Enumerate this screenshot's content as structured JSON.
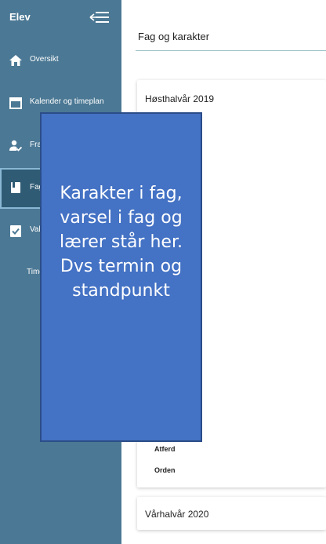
{
  "sidebar": {
    "title": "Elev",
    "items": [
      {
        "label": "Oversikt",
        "icon": "home-icon"
      },
      {
        "label": "Kalender og timeplan",
        "icon": "calendar-icon"
      },
      {
        "label": "Fravær",
        "icon": "person-check-icon"
      },
      {
        "label": "Fag og karakter",
        "icon": "book-icon",
        "active": true
      },
      {
        "label": "Valg",
        "icon": "clipboard-check-icon"
      },
      {
        "label": "Timeplan",
        "icon": "external-link-icon"
      }
    ]
  },
  "main": {
    "title": "Fag og karakter",
    "cards": [
      {
        "title": "Høsthalvår 2019",
        "rows": [
          "Atferd",
          "Orden"
        ]
      },
      {
        "title": "Vårhalvår 2020"
      }
    ],
    "overlay_note": "Karakter i fag, varsel i fag og lærer står her. Dvs termin og standpunkt"
  },
  "colors": {
    "sidebar_bg": "#4b7894",
    "active_bg": "#2f5b74",
    "overlay_bg": "#4472c4"
  }
}
